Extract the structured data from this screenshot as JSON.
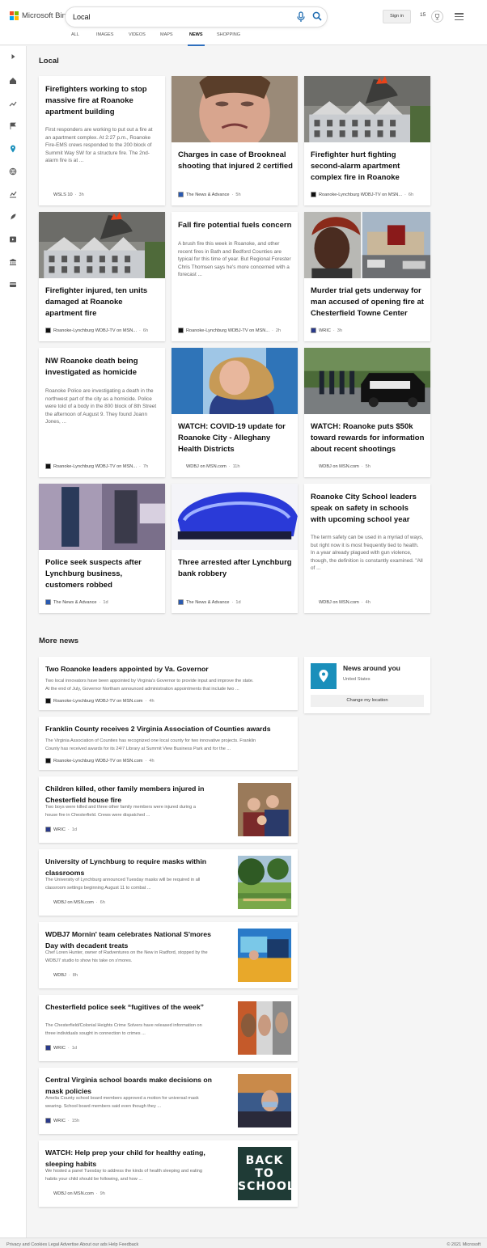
{
  "brand": {
    "name": "Microsoft Bing",
    "logo_colors": [
      "#f25022",
      "#7fba00",
      "#00a4ef",
      "#ffb900"
    ]
  },
  "search": {
    "value": "Local"
  },
  "header": {
    "sign_in": "Sign in",
    "points": "15",
    "accent": "#2e6fbd"
  },
  "tabs": [
    "ALL",
    "IMAGES",
    "VIDEOS",
    "MAPS",
    "NEWS",
    "SHOPPING"
  ],
  "active_tab": "NEWS",
  "sidebar_icons": [
    "chevron-right-icon",
    "home-icon",
    "trending-icon",
    "flag-icon",
    "location-pin-icon",
    "globe-icon",
    "chart-icon",
    "rocket-icon",
    "video-icon",
    "building-icon",
    "card-icon"
  ],
  "local": {
    "title": "Local",
    "cards": [
      {
        "title": "Firefighters working to stop massive fire at Roanoke apartment building",
        "snippet": "First responders are working to put out a fire at an apartment complex. At 2:27 p.m., Roanoke Fire-EMS crews responded to the 200 block of Summit Way SW for a structure fire. The 2nd-alarm fire is at ...",
        "provider": "WSLS 10",
        "ago": "3h",
        "image": "none"
      },
      {
        "title": "Charges in case of Brookneal shooting that injured 2 certified",
        "provider": "The News & Advance",
        "ago": "5h",
        "image": "crying-woman"
      },
      {
        "title": "Firefighter hurt fighting second-alarm apartment complex fire in Roanoke",
        "provider": "Roanoke-Lynchburg WDBJ-TV on MSN...",
        "ago": "6h",
        "image": "apartment-fire"
      },
      {
        "title": "Firefighter injured, ten units damaged at Roanoke apartment fire",
        "provider": "Roanoke-Lynchburg WDBJ-TV on MSN...",
        "ago": "6h",
        "image": "apartment-fire"
      },
      {
        "title": "Fall fire potential fuels concern",
        "snippet": "A brush fire this week in Roanoke, and other recent fires in Bath and Bedford Counties are typical for this time of year. But Regional Forester Chris Thomsen says he's more concerned with a forecast ...",
        "provider": "Roanoke-Lynchburg WDBJ-TV on MSN...",
        "ago": "2h",
        "image": "none"
      },
      {
        "title": "Murder trial gets underway for man accused of opening fire at Chesterfield Towne Center",
        "provider": "WRIC",
        "ago": "3h",
        "image": "mugshot-mall"
      },
      {
        "title": "NW Roanoke death being investigated as homicide",
        "snippet": "Roanoke Police are investigating a death in the northwest part of the city as a homicide. Police were told of a body in the 800 block of 8th Street the afternoon of August 9. They found Joann Jones, ...",
        "provider": "Roanoke-Lynchburg WDBJ-TV on MSN...",
        "ago": "7h",
        "image": "none"
      },
      {
        "title": "WATCH: COVID-19 update for Roanoke City - Alleghany Health Districts",
        "provider": "WDBJ on MSN.com",
        "ago": "11h",
        "image": "woman-portrait"
      },
      {
        "title": "WATCH: Roanoke puts $50k toward rewards for information about recent shootings",
        "provider": "WDBJ on MSN.com",
        "ago": "5h",
        "image": "police-scene"
      },
      {
        "title": "Police seek suspects after Lynchburg business, customers robbed",
        "provider": "The News & Advance",
        "ago": "1d",
        "image": "surveillance"
      },
      {
        "title": "Three arrested after Lynchburg bank robbery",
        "provider": "The News & Advance",
        "ago": "1d",
        "image": "police-light"
      },
      {
        "title": "Roanoke City School leaders speak on safety in schools with upcoming school year",
        "snippet": "The term safety can be used in a myriad of ways, but right now it is most frequently tied to health. In a year already plagued with gun violence, though, the definition is constantly examined. \"All of ...",
        "provider": "WDBJ on MSN.com",
        "ago": "4h",
        "image": "none"
      }
    ]
  },
  "more_news": {
    "title": "More news",
    "items": [
      {
        "title": "Two Roanoke leaders appointed by Va. Governor",
        "snippet": [
          "Two local innovators have been appointed by Virginia's Governor to provide input and improve the state.",
          "At the end of July, Governor Northam announced administration appointments that include two ..."
        ],
        "provider": "Roanoke-Lynchburg WDBJ-TV on MSN.com",
        "ago": "4h",
        "thumb": "none"
      },
      {
        "title": "Franklin County receives 2 Virginia Association of Counties awards",
        "snippet": [
          "The Virginia Association of Counties has recognized one local county for two innovative projects. Franklin",
          "County has received awards for its 24/7 Library at Summit View Business Park and for the ..."
        ],
        "provider": "Roanoke-Lynchburg WDBJ-TV on MSN.com",
        "ago": "4h",
        "thumb": "none"
      },
      {
        "title": "Children killed, other family members injured in Chesterfield house fire",
        "snippet": [
          "Two boys were killed and three other family members were injured during a",
          "house fire in Chesterfield. Crews were dispatched ..."
        ],
        "provider": "WRIC",
        "ago": "1d",
        "thumb": "family-photo"
      },
      {
        "title": "University of Lynchburg to require masks within classrooms",
        "snippet": [
          "The University of Lynchburg announced Tuesday masks will be required in all",
          "classroom settings beginning August 11 to combat ..."
        ],
        "provider": "WDBJ on MSN.com",
        "ago": "6h",
        "thumb": "campus"
      },
      {
        "title": "WDBJ7 Mornin' team celebrates National S'mores Day with decadent treats",
        "snippet": [
          "Chef Loren Hunter, owner of Radventures on the New in Radford, stopped by the",
          "WDBJ7 studio to show his take on s'mores."
        ],
        "provider": "WDBJ",
        "ago": "8h",
        "thumb": "tv-studio"
      },
      {
        "title": "Chesterfield police seek “fugitives of the week”",
        "snippet": [
          "The Chesterfield/Colonial Heights Crime Solvers have released information on",
          "three individuals sought in connection to crimes ..."
        ],
        "provider": "WRIC",
        "ago": "1d",
        "thumb": "mugshots"
      },
      {
        "title": "Central Virginia school boards make decisions on mask policies",
        "snippet": [
          "Amelia County school board members approved a motion for universal mask",
          "wearing. School board members said even though they ..."
        ],
        "provider": "WRIC",
        "ago": "15h",
        "thumb": "classroom"
      },
      {
        "title": "WATCH: Help prep your child for healthy eating, sleeping habits",
        "snippet": [
          "We hosted a panel Tuesday to address the kinds of health sleeping and eating",
          "habits your child should be following, and how ..."
        ],
        "provider": "WDBJ on MSN.com",
        "ago": "9h",
        "thumb": "chalkboard"
      }
    ]
  },
  "chalkboard_text": "BACK TO SCHOOL",
  "news_around_you": {
    "title": "News around you",
    "location": "United States",
    "button": "Change my location"
  },
  "footer": {
    "left": "Privacy and Cookies   Legal   Advertise   About our ads   Help   Feedback",
    "right": "© 2021 Microsoft"
  }
}
